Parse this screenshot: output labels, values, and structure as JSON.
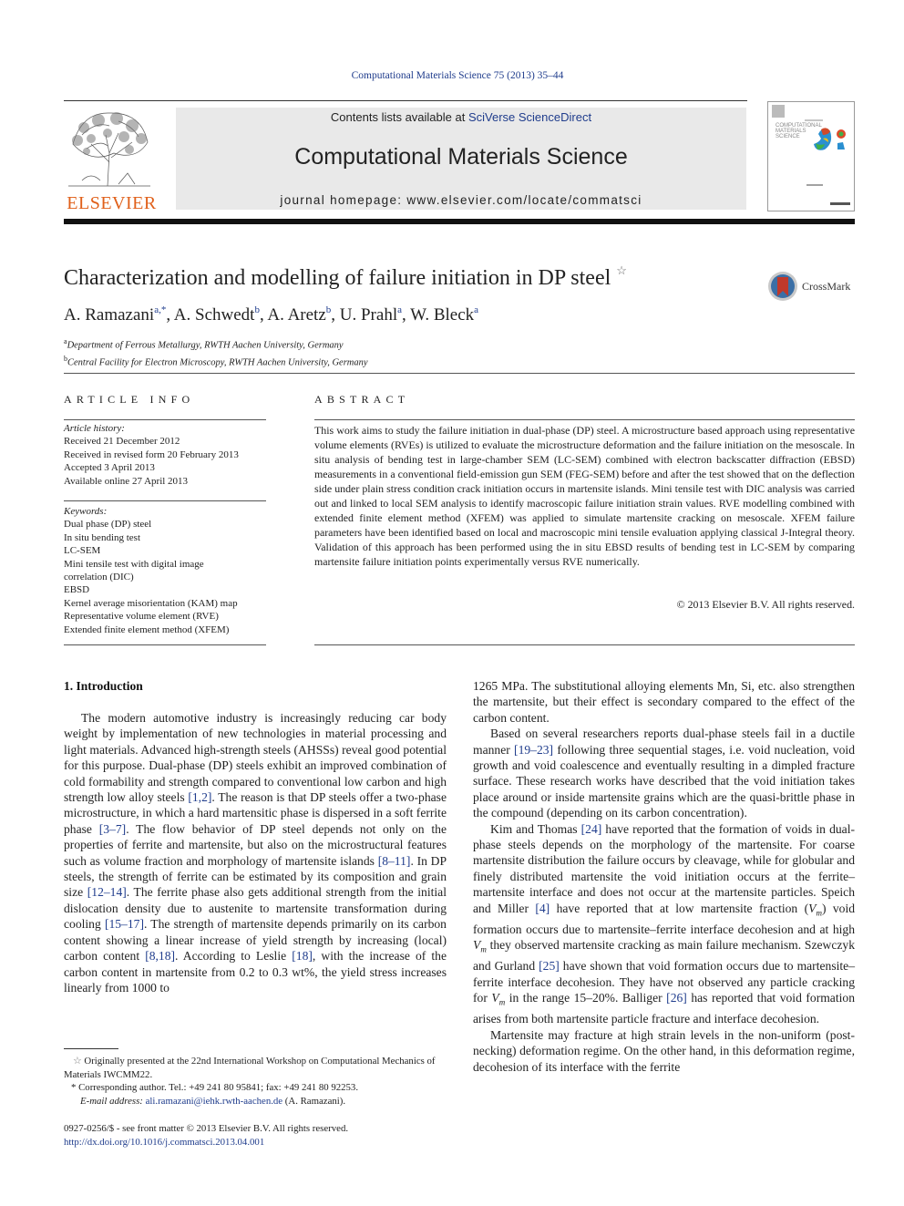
{
  "header": {
    "journal_ref": "Computational Materials Science 75 (2013) 35–44",
    "contents_prefix": "Contents lists available at ",
    "contents_link": "SciVerse ScienceDirect",
    "journal_title": "Computational Materials Science",
    "homepage": "journal homepage: www.elsevier.com/locate/commatsci",
    "publisher_logo": "ELSEVIER",
    "cover_title_lines": [
      "COMPUTATIONAL",
      "MATERIALS",
      "SCIENCE"
    ]
  },
  "article": {
    "title": "Characterization and modelling of failure initiation in DP steel",
    "title_note": "☆",
    "crossmark_label": "CrossMark",
    "authors": [
      {
        "name": "A. Ramazani",
        "sup": "a,*"
      },
      {
        "name": "A. Schwedt",
        "sup": "b"
      },
      {
        "name": "A. Aretz",
        "sup": "b"
      },
      {
        "name": "U. Prahl",
        "sup": "a"
      },
      {
        "name": "W. Bleck",
        "sup": "a"
      }
    ],
    "affiliations": [
      {
        "sup": "a",
        "text": "Department of Ferrous Metallurgy, RWTH Aachen University, Germany"
      },
      {
        "sup": "b",
        "text": "Central Facility for Electron Microscopy, RWTH Aachen University, Germany"
      }
    ]
  },
  "article_info": {
    "heading": "ARTICLE INFO",
    "history_label": "Article history:",
    "history": [
      "Received 21 December 2012",
      "Received in revised form 20 February 2013",
      "Accepted 3 April 2013",
      "Available online 27 April 2013"
    ],
    "keywords_label": "Keywords:",
    "keywords": [
      "Dual phase (DP) steel",
      "In situ bending test",
      "LC-SEM",
      "Mini tensile test with digital image correlation (DIC)",
      "EBSD",
      "Kernel average misorientation (KAM) map",
      "Representative volume element (RVE)",
      "Extended finite element method (XFEM)"
    ]
  },
  "abstract": {
    "heading": "ABSTRACT",
    "text": "This work aims to study the failure initiation in dual-phase (DP) steel. A microstructure based approach using representative volume elements (RVEs) is utilized to evaluate the microstructure deformation and the failure initiation on the mesoscale. In situ analysis of bending test in large-chamber SEM (LC-SEM) combined with electron backscatter diffraction (EBSD) measurements in a conventional field-emission gun SEM (FEG-SEM) before and after the test showed that on the deflection side under plain stress condition crack initiation occurs in martensite islands. Mini tensile test with DIC analysis was carried out and linked to local SEM analysis to identify macroscopic failure initiation strain values. RVE modelling combined with extended finite element method (XFEM) was applied to simulate martensite cracking on mesoscale. XFEM failure parameters have been identified based on local and macroscopic mini tensile evaluation applying classical J-Integral theory. Validation of this approach has been performed using the in situ EBSD results of bending test in LC-SEM by comparing martensite failure initiation points experimentally versus RVE numerically.",
    "copyright": "© 2013 Elsevier B.V. All rights reserved."
  },
  "body": {
    "section_heading": "1. Introduction",
    "left_col": [
      {
        "parts": [
          {
            "t": "The modern automotive industry is increasingly reducing car body weight by implementation of new technologies in material processing and light materials. Advanced high-strength steels (AHSSs) reveal good potential for this purpose. Dual-phase (DP) steels exhibit an improved combination of cold formability and strength compared to conventional low carbon and high strength low alloy steels "
          },
          {
            "ref": "[1,2]"
          },
          {
            "t": ". The reason is that DP steels offer a two-phase microstructure, in which a hard martensitic phase is dispersed in a soft ferrite phase "
          },
          {
            "ref": "[3–7]"
          },
          {
            "t": ". The flow behavior of DP steel depends not only on the properties of ferrite and martensite, but also on the microstructural features such as volume fraction and morphology of martensite islands "
          },
          {
            "ref": "[8–11]"
          },
          {
            "t": ". In DP steels, the strength of ferrite can be estimated by its composition and grain size "
          },
          {
            "ref": "[12–14]"
          },
          {
            "t": ". The ferrite phase also gets additional strength from the initial disloca­tion density due to austenite to martensite transformation during cooling "
          },
          {
            "ref": "[15–17]"
          },
          {
            "t": ". The strength of martensite depends primarily on its carbon content showing a linear increase of yield strength by increasing (local) carbon content "
          },
          {
            "ref": "[8,18]"
          },
          {
            "t": ". According to Leslie "
          },
          {
            "ref": "[18]"
          },
          {
            "t": ", with the increase of the carbon content in martensite from 0.2 to 0.3 wt%, the yield stress increases linearly from 1000 to"
          }
        ]
      }
    ],
    "right_col": [
      {
        "noindent": true,
        "parts": [
          {
            "t": "1265 MPa. The substitutional alloying elements Mn, Si, etc. also strengthen the martensite, but their effect is secondary compared to the effect of the carbon content."
          }
        ]
      },
      {
        "parts": [
          {
            "t": "Based on several researchers reports dual-phase steels fail in a ductile manner "
          },
          {
            "ref": "[19–23]"
          },
          {
            "t": " following three sequential stages, i.e. void nucleation, void growth and void coalescence and eventually resulting in a dimpled fracture surface. These research works have described that the void initiation takes place around or inside mar­tensite grains which are the quasi-brittle phase in the compound (depending on its carbon concentration)."
          }
        ]
      },
      {
        "parts": [
          {
            "t": "Kim and Thomas "
          },
          {
            "ref": "[24]"
          },
          {
            "t": " have reported that the formation of voids in dual-phase steels depends on the morphology of the martensite. For coarse martensite distribution the failure occurs by cleavage, while for globular and finely distributed martensite the void initi­ation occurs at the ferrite–martensite interface and does not occur at the martensite particles. Speich and Miller "
          },
          {
            "ref": "[4]"
          },
          {
            "t": " have reported that at low martensite fraction ("
          },
          {
            "vm": "V",
            "sub": "m"
          },
          {
            "t": ") void formation occurs due to mar­tensite–ferrite interface decohesion and at high "
          },
          {
            "vm": "V",
            "sub": "m"
          },
          {
            "t": " they observed martensite cracking as main failure mechanism. Szewczyk and Gurland "
          },
          {
            "ref": "[25]"
          },
          {
            "t": " have shown that void formation occurs due to martensite–ferrite interface decohesion. They have not observed any particle cracking for "
          },
          {
            "vm": "V",
            "sub": "m"
          },
          {
            "t": " in the range 15–20%. Balliger "
          },
          {
            "ref": "[26]"
          },
          {
            "t": " has reported that void formation arises from both martensite particle fracture and interface decohesion."
          }
        ]
      },
      {
        "parts": [
          {
            "t": "Martensite may fracture at high strain levels in the non-uniform (post-necking) deformation regime. On the other hand, in this deformation regime, decohesion of its interface with the ferrite"
          }
        ]
      }
    ]
  },
  "footnotes": {
    "note1_symbol": "☆",
    "note1": "Originally presented at the 22nd International Workshop on Computational Mechanics of Materials IWCMM22.",
    "note2_symbol": "*",
    "note2": "Corresponding author. Tel.: +49 241 80 95841; fax: +49 241 80 92253.",
    "email_label": "E-mail address:",
    "email": "ali.ramazani@iehk.rwth-aachen.de",
    "email_suffix": " (A. Ramazani).",
    "front_matter": "0927-0256/$ - see front matter © 2013 Elsevier B.V. All rights reserved.",
    "doi": "http://dx.doi.org/10.1016/j.commatsci.2013.04.001"
  },
  "colors": {
    "link": "#1f3c8c",
    "elsevier_orange": "#e0601a",
    "banner_gray": "#e9e9e9"
  }
}
